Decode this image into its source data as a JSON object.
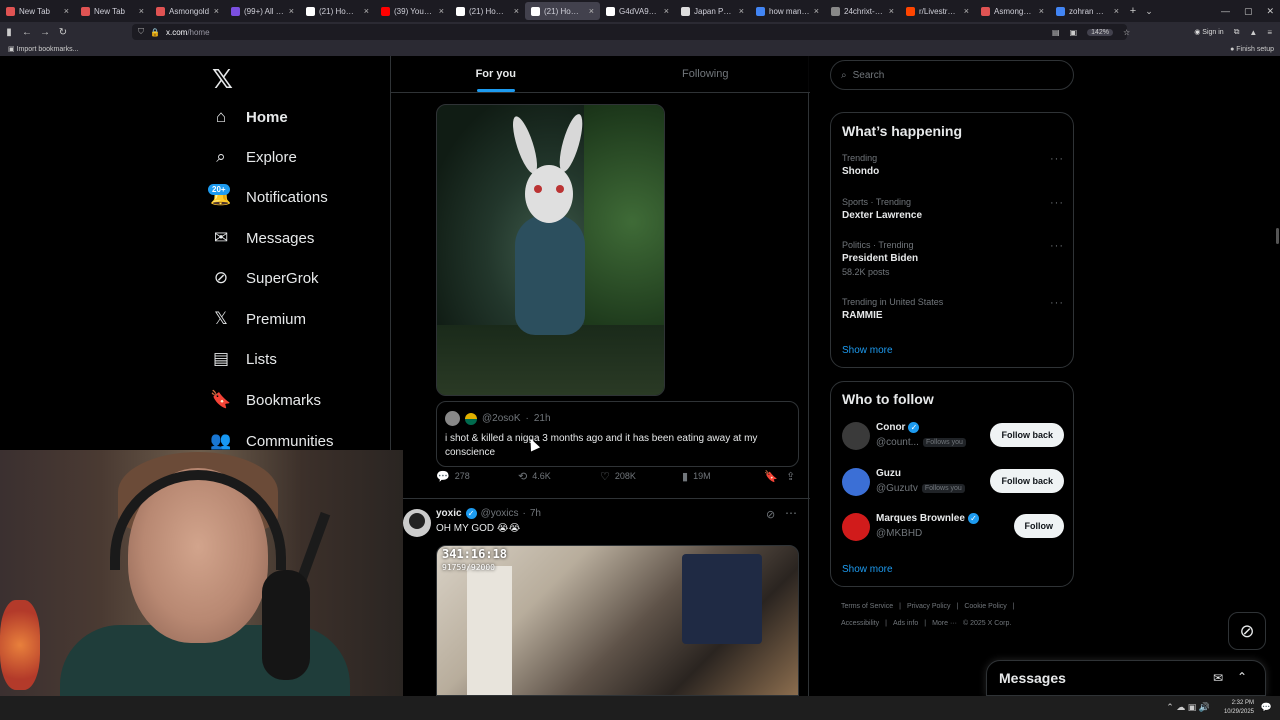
{
  "browser": {
    "tabs": [
      {
        "label": "New Tab",
        "color": "#e05353"
      },
      {
        "label": "New Tab",
        "color": "#e05353"
      },
      {
        "label": "Asmongold",
        "color": "#e05353"
      },
      {
        "label": "(99+) All Catego",
        "color": "#7b4fe0"
      },
      {
        "label": "(21) Home / X",
        "color": "#ffffff"
      },
      {
        "label": "(39) YouTube",
        "color": "#ff0000"
      },
      {
        "label": "(21) Home / X",
        "color": "#ffffff"
      },
      {
        "label": "(21) Home / X",
        "color": "#ffffff",
        "active": true
      },
      {
        "label": "G4dVA9XgAlhLi",
        "color": "#ffffff"
      },
      {
        "label": "Japan Patent Offi",
        "color": "#dddddd"
      },
      {
        "label": "how many peopl",
        "color": "#4285f4"
      },
      {
        "label": "24chrixt-span-su",
        "color": "#888888"
      },
      {
        "label": "r/LivestreamFail",
        "color": "#ff4500"
      },
      {
        "label": "Asmongold laugl",
        "color": "#e05353"
      },
      {
        "label": "zohran mamdani",
        "color": "#4285f4"
      }
    ],
    "tab_close": "×",
    "new_tab": "+",
    "tab_list": "⌄",
    "window_controls": {
      "minimize": "—",
      "maximize": "▢",
      "close": "✕"
    },
    "url_host": "x.com",
    "url_path": "/home",
    "zoom": "142%",
    "signin": "Sign in",
    "bookmarks_import": "Import bookmarks...",
    "finish_setup": "Finish setup"
  },
  "x": {
    "logo": "𝕏",
    "nav": [
      {
        "label": "Home",
        "icon": "home-icon",
        "glyph": "⌂"
      },
      {
        "label": "Explore",
        "icon": "search-icon",
        "glyph": "⌕"
      },
      {
        "label": "Notifications",
        "icon": "bell-icon",
        "glyph": "🔔"
      },
      {
        "label": "Messages",
        "icon": "envelope-icon",
        "glyph": "✉"
      },
      {
        "label": "SuperGrok",
        "icon": "grok-icon",
        "glyph": "⊘"
      },
      {
        "label": "Premium",
        "icon": "x-logo-icon",
        "glyph": "𝕏"
      },
      {
        "label": "Lists",
        "icon": "list-icon",
        "glyph": "▤"
      },
      {
        "label": "Bookmarks",
        "icon": "bookmark-icon",
        "glyph": "🔖"
      },
      {
        "label": "Communities",
        "icon": "people-icon",
        "glyph": "👥"
      }
    ],
    "notifications_badge": "20+",
    "tabs": {
      "for_you": "For you",
      "following": "Following"
    },
    "quoted": {
      "handle": "@2osoK",
      "time": "21h",
      "text": "i shot & killed a nigga 3 months ago and it has been eating away at my conscience"
    },
    "post1_actions": {
      "replies": "278",
      "reposts": "4.6K",
      "likes": "208K",
      "views": "19M"
    },
    "action_icons": {
      "reply": "💬",
      "repost": "⟲",
      "like": "♡",
      "views": "▮",
      "bookmark": "🔖",
      "share": "⇪"
    },
    "post2": {
      "name": "yoxic",
      "handle": "@yoxics",
      "time": "7h",
      "text": "OH MY GOD 😭😭",
      "video_timer": "341:16:18",
      "video_counter": "91759/92000"
    },
    "post2_icons": {
      "grok": "⊘",
      "more": "⋯"
    },
    "search_placeholder": "Search",
    "search_glyph": "⌕",
    "happening_title": "What’s happening",
    "trends": [
      {
        "meta": "Trending",
        "name": "Shondo",
        "posts": ""
      },
      {
        "meta": "Sports · Trending",
        "name": "Dexter Lawrence",
        "posts": ""
      },
      {
        "meta": "Politics · Trending",
        "name": "President Biden",
        "posts": "58.2K posts"
      },
      {
        "meta": "Trending in United States",
        "name": "RAMMIE",
        "posts": ""
      }
    ],
    "trend_more": "···",
    "show_more": "Show more",
    "who_to_follow_title": "Who to follow",
    "who_to_follow": [
      {
        "name": "Conor",
        "handle": "@count...",
        "follows_you": "Follows you",
        "button": "Follow back",
        "verified": true,
        "avatar_color": "#3a3a3a"
      },
      {
        "name": "Guzu",
        "handle": "@Guzutv",
        "follows_you": "Follows you",
        "button": "Follow back",
        "verified": false,
        "avatar_color": "#3b6fd6"
      },
      {
        "name": "Marques Brownlee",
        "handle": "@MKBHD",
        "follows_you": "",
        "button": "Follow",
        "verified": true,
        "avatar_color": "#d11b1b"
      }
    ],
    "verified_mark": "✓",
    "footer_row1": [
      "Terms of Service",
      "|",
      "Privacy Policy",
      "|",
      "Cookie Policy",
      "|"
    ],
    "footer_row2": [
      "Accessibility",
      "|",
      "Ads info",
      "|",
      "More ···",
      "© 2025 X Corp."
    ],
    "messages_title": "Messages",
    "messages_compose": "✉",
    "messages_expand": "⌃",
    "grok_fab": "⊘"
  },
  "taskbar": {
    "tray": "⌃ ☁ ▣ 🔊",
    "time": "2:32 PM",
    "date": "10/29/2025",
    "notify": "💬"
  },
  "colors": {
    "accent": "#1d9bf0",
    "bg": "#000000",
    "border": "#2f3336",
    "muted": "#71767b"
  }
}
